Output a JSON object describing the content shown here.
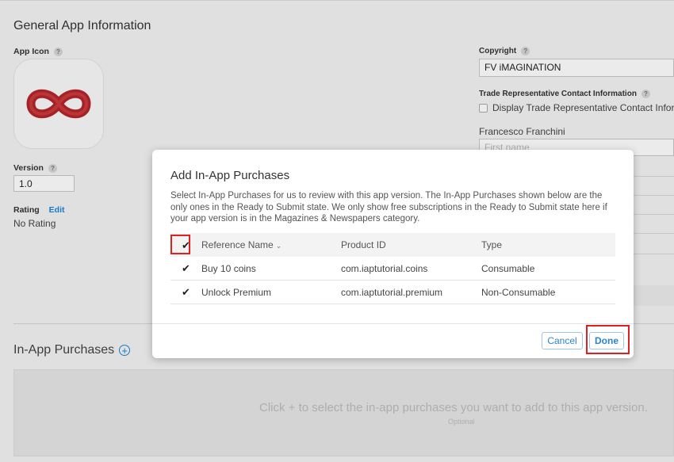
{
  "general": {
    "title": "General App Information",
    "app_icon_label": "App Icon",
    "help": "?",
    "version_label": "Version",
    "version_value": "1.0",
    "rating_label": "Rating",
    "rating_edit": "Edit",
    "rating_value": "No Rating",
    "copyright_label": "Copyright",
    "copyright_value": "FV iMAGINATION",
    "trade_rep_label": "Trade Representative Contact Information",
    "trade_rep_checkbox": "Display Trade Representative Contact Inform",
    "contact_name": "Francesco Franchini",
    "first_name_placeholder": "First name"
  },
  "iap_section": {
    "title": "In-App Purchases",
    "empty_text": "Click + to select the in-app purchases you want to add to this app version.",
    "empty_sub": "Optional"
  },
  "modal": {
    "title": "Add In-App Purchases",
    "description": "Select In-App Purchases for us to review with this app version. The In-App Purchases shown below are the only ones in the Ready to Submit state. We only show free subscriptions in the Ready to Submit state here if your app version is in the Magazines & Newspapers category.",
    "columns": [
      "Reference Name",
      "Product ID",
      "Type"
    ],
    "rows": [
      {
        "name": "Buy 10 coins",
        "product_id": "com.iaptutorial.coins",
        "type": "Consumable",
        "checked": true
      },
      {
        "name": "Unlock Premium",
        "product_id": "com.iaptutorial.premium",
        "type": "Non-Consumable",
        "checked": true
      }
    ],
    "check_glyph": "✔",
    "sort_caret": "⌄",
    "cancel_label": "Cancel",
    "done_label": "Done"
  },
  "colors": {
    "accent": "#1a84d8",
    "highlight": "#e02020"
  }
}
